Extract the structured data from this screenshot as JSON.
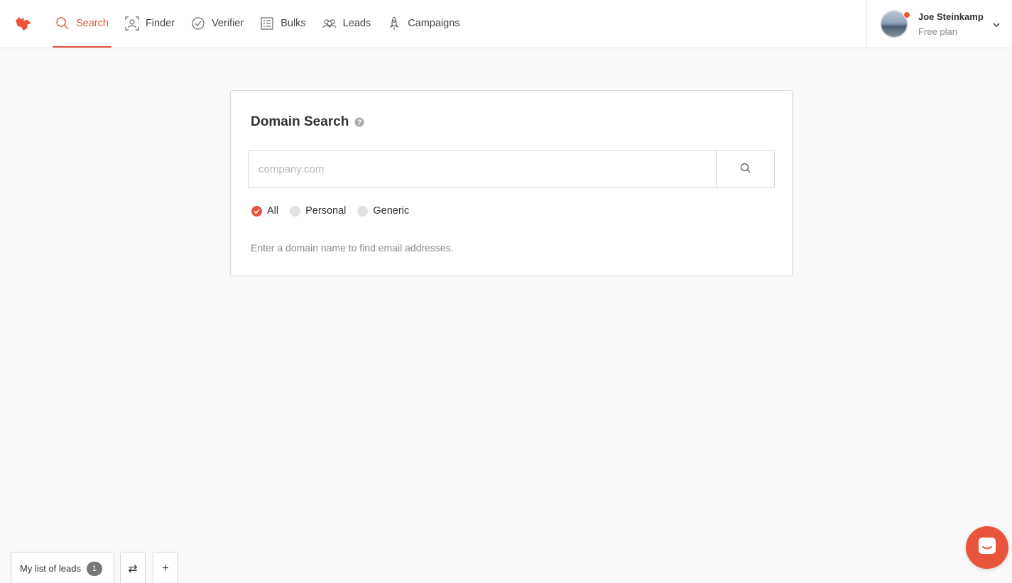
{
  "nav": {
    "items": [
      {
        "label": "Search",
        "icon": "search-icon",
        "active": true
      },
      {
        "label": "Finder",
        "icon": "finder-icon",
        "active": false
      },
      {
        "label": "Verifier",
        "icon": "check-circle-icon",
        "active": false
      },
      {
        "label": "Bulks",
        "icon": "list-icon",
        "active": false
      },
      {
        "label": "Leads",
        "icon": "people-icon",
        "active": false
      },
      {
        "label": "Campaigns",
        "icon": "rocket-icon",
        "active": false
      }
    ]
  },
  "profile": {
    "name": "Joe Steinkamp",
    "plan": "Free plan"
  },
  "domain_search": {
    "title": "Domain Search",
    "placeholder": "company.com",
    "value": "",
    "filters": [
      {
        "label": "All",
        "checked": true
      },
      {
        "label": "Personal",
        "checked": false
      },
      {
        "label": "Generic",
        "checked": false
      }
    ],
    "hint": "Enter a domain name to find email addresses."
  },
  "leads_bar": {
    "list_label": "My list of leads",
    "count": "1",
    "swap_icon": "⇄",
    "add_icon": "+"
  },
  "colors": {
    "accent": "#e8543c",
    "background": "#fafafa"
  }
}
